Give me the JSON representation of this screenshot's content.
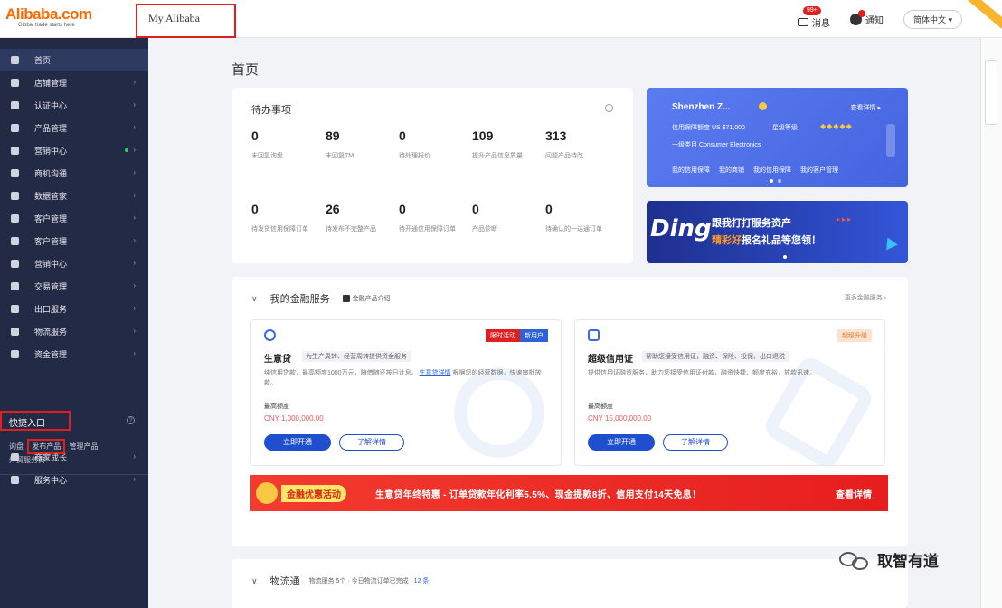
{
  "topbar": {
    "logo_text": "Alibaba.com",
    "logo_tagline": "Global trade starts here",
    "my_alibaba": "My Alibaba",
    "messages_badge": "99+",
    "messages_label": "消息",
    "notify_label": "通知",
    "language": "简体中文"
  },
  "sidebar": {
    "items": [
      {
        "label": "首页",
        "icon": "home-icon",
        "active": true
      },
      {
        "label": "店铺管理",
        "icon": "store-icon"
      },
      {
        "label": "认证中心",
        "icon": "shield-icon"
      },
      {
        "label": "产品管理",
        "icon": "box-icon"
      },
      {
        "label": "营销中心",
        "icon": "marketing-icon",
        "dot": true
      },
      {
        "label": "商机沟通",
        "icon": "chat-icon"
      },
      {
        "label": "数据管家",
        "icon": "chart-icon"
      },
      {
        "label": "客户管理",
        "icon": "bulb-icon"
      },
      {
        "label": "客户管理",
        "icon": "user-icon"
      },
      {
        "label": "营销中心",
        "icon": "arrow-icon"
      },
      {
        "label": "交易管理",
        "icon": "doc-icon"
      },
      {
        "label": "出口服务",
        "icon": "globe-icon"
      },
      {
        "label": "物流服务",
        "icon": "truck-icon"
      },
      {
        "label": "资金管理",
        "icon": "bank-icon"
      }
    ],
    "quick_entry": "快捷入口",
    "quick_links_line1_a": "询盘",
    "quick_links_line1_b": "发布产品",
    "quick_links_line1_c": "管理产品",
    "quick_links_line2": "外贸服务商",
    "bottom_items": [
      {
        "label": "商家成长",
        "icon": "heart-icon"
      },
      {
        "label": "服务中心",
        "icon": "service-icon"
      }
    ]
  },
  "page": {
    "title": "首页"
  },
  "todo": {
    "title": "待办事项",
    "stats_row1": [
      {
        "num": "0",
        "label": "未回复询盘"
      },
      {
        "num": "89",
        "label": "未回复TM"
      },
      {
        "num": "0",
        "label": "待处理报价"
      },
      {
        "num": "109",
        "label": "提升产品信息质量"
      },
      {
        "num": "313",
        "label": "问题产品待改"
      }
    ],
    "stats_row2": [
      {
        "num": "0",
        "label": "待发货信用保障订单"
      },
      {
        "num": "26",
        "label": "待发布不完整产品"
      },
      {
        "num": "0",
        "label": "待开通信用保障订单"
      },
      {
        "num": "0",
        "label": "产品诊断"
      },
      {
        "num": "0",
        "label": "待确认的一达通订单"
      }
    ]
  },
  "promo1": {
    "company": "Shenzhen Z...",
    "version": "查看详情",
    "row2_a": "信用保障额度 US $71,000",
    "row2_b": "星级等级",
    "row3": "一级类目 Consumer Electronics",
    "links": [
      "我的信用保障",
      "我的商铺",
      "我的信用保障",
      "我的客户管理"
    ]
  },
  "promo2": {
    "ding": "Ding",
    "line1": "跟我打打服务资产",
    "line2a": "精彩好",
    "line2b": "报名礼品等您领！"
  },
  "finance": {
    "title": "我的金融服务",
    "sub": "金融产品介绍",
    "more": "更多金融服务",
    "products": [
      {
        "name": "生意贷",
        "desc": "为生产周转、经营周转提供资金服务",
        "text": "纯信用贷款，最高额度1000万元，随借随还按日计息。",
        "link": "生意贷详情",
        "text2": "根据您的经营数据，快速审批放款。",
        "amount_label": "最高额度",
        "amount": "CNY 1,000,000.00",
        "btn_a": "立即开通",
        "btn_b": "了解详情",
        "tags": [
          "限时活动",
          "新用户"
        ]
      },
      {
        "name": "超级信用证",
        "desc": "帮助您接受信用证，融资、保险、投保、出口退税",
        "text": "提供信用证融资服务，助力您接受信用证付款，融资快捷、额度充裕，放款迅速。",
        "amount_label": "最高额度",
        "amount": "CNY 15,000,000.00",
        "btn_a": "立即开通",
        "btn_b": "了解详情",
        "tags": [
          "超级升级"
        ]
      }
    ]
  },
  "banner": {
    "tag": "金融优惠活动",
    "text": "生意贷年终特惠 - 订单贷款年化利率5.5%、现金提款8折、信用支付14天免息！",
    "more": "查看详情"
  },
  "yxt": {
    "title": "物流通",
    "sub": "物流服务 5个 · 今日物流订单已完成",
    "link": "12 条"
  },
  "watermark": {
    "text": "取智有道"
  },
  "colors": {
    "sidebar_bg": "#232a45",
    "accent_blue": "#1f4fcf",
    "brand_orange": "#ff6a00",
    "banner_red": "#e61e1e",
    "highlight_red": "#e02020"
  }
}
